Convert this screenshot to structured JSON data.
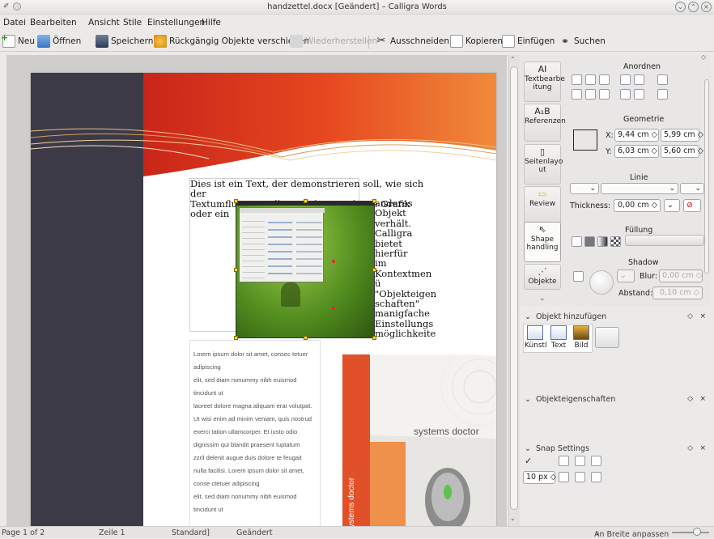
{
  "window": {
    "title": "handzettel.docx [Geändert] – Calligra Words"
  },
  "menu": [
    "Datei",
    "Bearbeiten",
    "Ansicht",
    "Stile",
    "Einstellungen",
    "Hilfe"
  ],
  "toolbar": {
    "new": "Neu",
    "open": "Öffnen",
    "save": "Speichern",
    "undo": "Rückgängig Objekte verschieben",
    "redo": "Wiederherstellen",
    "cut": "Ausschneiden",
    "copy": "Kopieren",
    "paste": "Einfügen",
    "find": "Suchen"
  },
  "document": {
    "flow_lines": [
      "Dies ist ein Text, der demonstrieren soll, wie sich der",
      "Textumfluss in Galligra in bezu auf eine Grafik oder ein"
    ],
    "wrap_lines": [
      "anderes",
      "Objekt",
      "verhält.",
      "Calligra",
      "bietet hierfür",
      "im",
      "Kontextmen",
      "ü",
      "\"Objekteigen",
      "schaften\"",
      "manigfache",
      "Einstellungs",
      "möglichkeite"
    ],
    "lorem_lines": [
      "Lorem ipsum dolor sit amet, consec tetuer",
      "adipiscing",
      "elit, sed diam nonummy nibh euismod",
      "tincidunt ut",
      "laoreet dolore magna aliquam erat volutpat.",
      "Ut wisi enim ad minim veniam, quis nostrud",
      "exerci tation ullamcorper. Et iusto odio",
      "dignissim qui blandit praesent luptatum",
      "zzril delenit augue duis dolore te feugait",
      "nulla facilisi. Lorem ipsum dolor sit amet,",
      "conse ctetuer adipiscing",
      "elit, sed diam nonummy nibh euismod",
      "tincidunt ut"
    ],
    "box_brand": "systems doctor",
    "box_side": "systems doctor"
  },
  "side_tabs": [
    {
      "label": "Textbearbe itung"
    },
    {
      "label": "Referenzen"
    },
    {
      "label": "Seitenlayo ut"
    },
    {
      "label": "Review"
    },
    {
      "label": "Shape handling"
    },
    {
      "label": "Objekte"
    }
  ],
  "shape_panel": {
    "arrange_title": "Anordnen",
    "geometry_title": "Geometrie",
    "x_label": "X:",
    "x_value": "9,44 cm",
    "w_value": "5,99 cm",
    "y_label": "Y:",
    "y_value": "6,03 cm",
    "h_value": "5,60 cm",
    "line_title": "Linie",
    "thickness_label": "Thickness:",
    "thickness_value": "0,00 cm",
    "fill_title": "Füllung",
    "shadow_title": "Shadow",
    "blur_label": "Blur:",
    "blur_value": "0,00 cm",
    "distance_label": "Abstand:",
    "distance_value": "0,10 cm"
  },
  "add_object": {
    "title": "Objekt hinzufügen",
    "items": [
      "Künstl",
      "Text",
      "Bild"
    ]
  },
  "object_props": {
    "title": "Objekteigenschaften"
  },
  "snap": {
    "title": "Snap Settings",
    "px_value": "10 px"
  },
  "status": {
    "page": "Page 1 of 2",
    "line": "Zeile 1",
    "style": "Standard]",
    "modified": "Geändert",
    "zoom": "An Breite anpassen"
  },
  "colors": {
    "accent": "#e05a1e",
    "dark_column": "#3c3a47"
  }
}
